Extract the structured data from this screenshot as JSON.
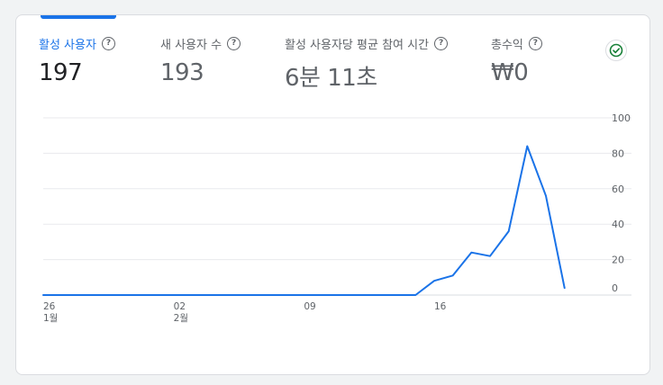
{
  "metrics": [
    {
      "label": "활성 사용자",
      "value": "197",
      "active": true
    },
    {
      "label": "새 사용자 수",
      "value": "193",
      "active": false
    },
    {
      "label": "활성 사용자당 평균 참여 시간",
      "value": "6분 11초",
      "active": false
    },
    {
      "label": "총수익",
      "value": "₩0",
      "active": false
    }
  ],
  "colors": {
    "accent": "#1a73e8",
    "success": "#188038"
  },
  "status_icon": "check-circle-icon",
  "chart_data": {
    "type": "line",
    "title": "",
    "xlabel": "",
    "ylabel": "",
    "ylim": [
      0,
      100
    ],
    "y_ticks": [
      "100",
      "80",
      "60",
      "40",
      "20",
      "0"
    ],
    "x_tick_labels": [
      {
        "day": "26",
        "month": "1월"
      },
      {
        "day": "02",
        "month": "2월"
      },
      {
        "day": "09",
        "month": ""
      },
      {
        "day": "16",
        "month": ""
      }
    ],
    "x": [
      "01-26",
      "01-27",
      "01-28",
      "01-29",
      "01-30",
      "01-31",
      "02-01",
      "02-02",
      "02-03",
      "02-04",
      "02-05",
      "02-06",
      "02-07",
      "02-08",
      "02-09",
      "02-10",
      "02-11",
      "02-12",
      "02-13",
      "02-14",
      "02-15",
      "02-16",
      "02-17",
      "02-18",
      "02-19",
      "02-20",
      "02-21",
      "02-22",
      "02-23",
      "02-24",
      "02-25"
    ],
    "series": [
      {
        "values": [
          0,
          0,
          0,
          0,
          0,
          0,
          0,
          0,
          0,
          0,
          0,
          0,
          0,
          0,
          0,
          0,
          0,
          0,
          0,
          0,
          0,
          8,
          11,
          24,
          22,
          36,
          84,
          56,
          4
        ]
      }
    ],
    "grid": true
  }
}
